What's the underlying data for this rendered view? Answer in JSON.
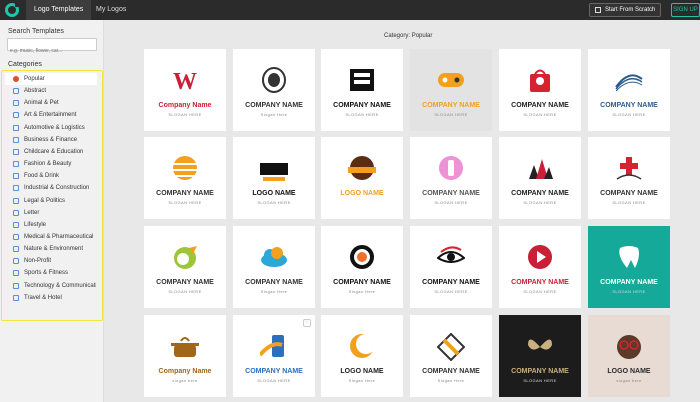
{
  "topbar": {
    "tabs": [
      "Logo Templates",
      "My Logos"
    ],
    "start_label": "Start From Scratch",
    "signup_label": "SIGN UP"
  },
  "sidebar": {
    "search_heading": "Search Templates",
    "search_placeholder": "e.g. music, flower, car...",
    "categories_heading": "Categories",
    "categories": [
      "Popular",
      "Abstract",
      "Animal & Pet",
      "Art & Entertainment",
      "Automotive & Logistics",
      "Business & Finance",
      "Childcare & Education",
      "Fashion & Beauty",
      "Food & Drink",
      "Industrial & Construction",
      "Legal & Politics",
      "Letter",
      "Lifestyle",
      "Medical & Pharmaceutical",
      "Nature & Environment",
      "Non-Profit",
      "Sports & Fitness",
      "Technology & Communicati",
      "Travel & Hotel"
    ]
  },
  "main": {
    "category_prefix": "Category:",
    "category_value": "Popular",
    "cards": [
      {
        "name": "Company Name",
        "slogan": "SLOGAN HERE",
        "bg": "#ffffff",
        "color": "#c91f37",
        "icon": "w-letter-icon"
      },
      {
        "name": "COMPANY NAME",
        "slogan": "Slogan Here",
        "bg": "#ffffff",
        "color": "#333333",
        "icon": "oval-badge-icon"
      },
      {
        "name": "COMPANY NAME",
        "slogan": "SLOGAN HERE",
        "bg": "#ffffff",
        "color": "#111111",
        "icon": "square-emblem-icon"
      },
      {
        "name": "COMPANY NAME",
        "slogan": "SLOGAN HERE",
        "bg": "#e3e3e3",
        "color": "#f2a01e",
        "icon": "gamepad-icon"
      },
      {
        "name": "COMPANY NAME",
        "slogan": "SLOGAN HERE",
        "bg": "#ffffff",
        "color": "#222222",
        "icon": "shopping-bag-pin-icon"
      },
      {
        "name": "COMPANY NAME",
        "slogan": "SLOGAN HERE",
        "bg": "#ffffff",
        "color": "#2a5d8f",
        "icon": "wave-arc-icon"
      },
      {
        "name": "COMPANY NAME",
        "slogan": "SLOGAN HERE",
        "bg": "#ffffff",
        "color": "#333333",
        "icon": "striped-sphere-icon"
      },
      {
        "name": "LOGO NAME",
        "slogan": "SLOGAN HERE",
        "bg": "#ffffff",
        "color": "#111111",
        "icon": "notebook-banner-icon"
      },
      {
        "name": "LOGO NAME",
        "slogan": "",
        "bg": "#ffffff",
        "color": "#f2a01e",
        "icon": "food-basket-badge-icon"
      },
      {
        "name": "COMPANY NAME",
        "slogan": "SLOGAN HERE",
        "bg": "#ffffff",
        "color": "#555555",
        "icon": "lipstick-circle-icon"
      },
      {
        "name": "COMPANY NAME",
        "slogan": "SLOGAN HERE",
        "bg": "#ffffff",
        "color": "#222222",
        "icon": "building-skyline-icon"
      },
      {
        "name": "COMPANY NAME",
        "slogan": "SLOGAN HERE",
        "bg": "#ffffff",
        "color": "#333333",
        "icon": "medical-cross-icon"
      },
      {
        "name": "COMPANY NAME",
        "slogan": "SLOGAN HERE",
        "bg": "#ffffff",
        "color": "#333333",
        "icon": "globe-leaf-icon"
      },
      {
        "name": "COMPANY NAME",
        "slogan": "Slogan Here",
        "bg": "#ffffff",
        "color": "#333333",
        "icon": "cloud-icon"
      },
      {
        "name": "COMPANY NAME",
        "slogan": "Slogan Here",
        "bg": "#ffffff",
        "color": "#111111",
        "icon": "sushi-roll-icon"
      },
      {
        "name": "COMPANY NAME",
        "slogan": "SLOGAN HERE",
        "bg": "#ffffff",
        "color": "#111111",
        "icon": "eye-icon"
      },
      {
        "name": "COMPANY NAME",
        "slogan": "SLOGAN HERE",
        "bg": "#ffffff",
        "color": "#c91f37",
        "icon": "play-arrow-circle-icon"
      },
      {
        "name": "COMPANY NAME",
        "slogan": "SLOGAN HERE",
        "bg": "#15a99a",
        "color": "#ffffff",
        "icon": "tooth-icon"
      },
      {
        "name": "Company Name",
        "slogan": "slogan here",
        "bg": "#ffffff",
        "color": "#a0661a",
        "icon": "cooking-pot-icon"
      },
      {
        "name": "COMPANY NAME",
        "slogan": "SLOGAN HERE",
        "bg": "#ffffff",
        "color": "#2a6fc0",
        "icon": "phone-swoosh-icon"
      },
      {
        "name": "LOGO NAME",
        "slogan": "Slogan Here",
        "bg": "#ffffff",
        "color": "#222222",
        "icon": "moon-circle-icon"
      },
      {
        "name": "COMPANY NAME",
        "slogan": "Slogan Here",
        "bg": "#ffffff",
        "color": "#333333",
        "icon": "diamond-x-icon"
      },
      {
        "name": "COMPANY NAME",
        "slogan": "SLOGAN HERE",
        "bg": "#1c1c1c",
        "color": "#c9b081",
        "icon": "butterfly-icon"
      },
      {
        "name": "LOGO NAME",
        "slogan": "slogan here",
        "bg": "#e7dbd3",
        "color": "#2b2b2b",
        "icon": "bear-glasses-icon"
      }
    ]
  }
}
